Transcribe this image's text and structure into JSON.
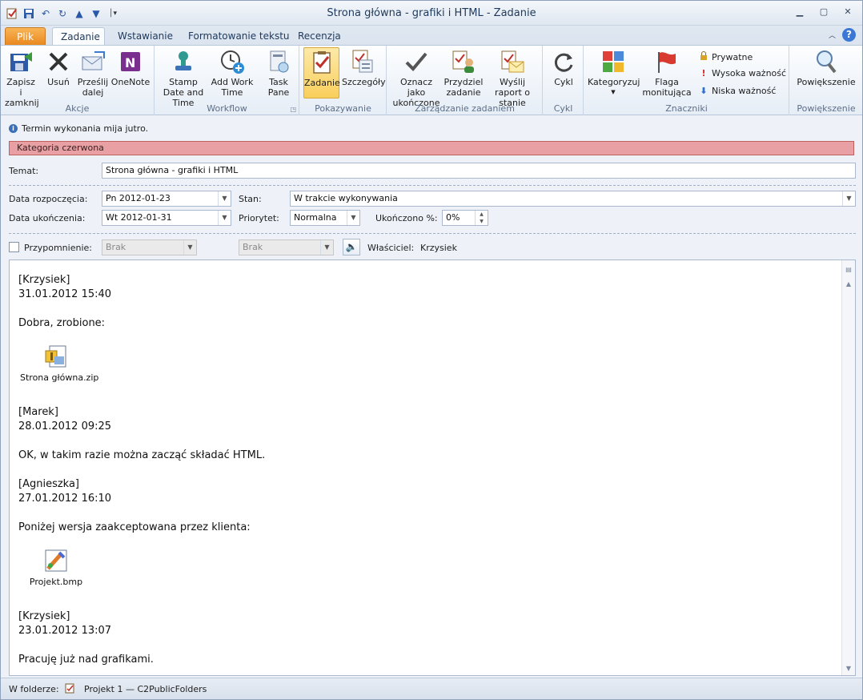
{
  "window": {
    "title": "Strona główna - grafiki i HTML  -  Zadanie"
  },
  "tabs": [
    {
      "label": "Plik"
    },
    {
      "label": "Zadanie"
    },
    {
      "label": "Wstawianie"
    },
    {
      "label": "Formatowanie tekstu"
    },
    {
      "label": "Recenzja"
    }
  ],
  "ribbon": {
    "akcje": {
      "label": "Akcje",
      "save": "Zapisz i zamknij",
      "delete": "Usuń",
      "forward": "Prześlij dalej",
      "onenote": "OneNote"
    },
    "workflow": {
      "label": "Workflow",
      "stamp": "Stamp Date and Time",
      "addwork": "Add Work Time",
      "taskpane": "Task Pane"
    },
    "pokazywanie": {
      "label": "Pokazywanie",
      "zadanie": "Zadanie",
      "szczegoly": "Szczegóły"
    },
    "zarzadzanie": {
      "label": "Zarządzanie zadaniem",
      "oznacz": "Oznacz jako ukończone",
      "przydziel": "Przydziel zadanie",
      "wyslij": "Wyślij raport o stanie"
    },
    "cykl": {
      "label": "Cykl",
      "cykl": "Cykl"
    },
    "znaczniki": {
      "label": "Znaczniki",
      "kategoryzuj": "Kategoryzuj",
      "flaga": "Flaga monitująca",
      "prywatne": "Prywatne",
      "wysoka": "Wysoka ważność",
      "niska": "Niska ważność"
    },
    "powiekszenie": {
      "label": "Powiększenie",
      "powiekszenie": "Powiększenie"
    }
  },
  "form": {
    "info": "Termin wykonania mija jutro.",
    "category": "Kategoria czerwona",
    "subject_label": "Temat:",
    "subject": "Strona główna - grafiki i HTML",
    "start_label": "Data rozpoczęcia:",
    "start": "Pn 2012-01-23",
    "due_label": "Data ukończenia:",
    "due": "Wt 2012-01-31",
    "status_label": "Stan:",
    "status": "W trakcie wykonywania",
    "priority_label": "Priorytet:",
    "priority": "Normalna",
    "complete_label": "Ukończono %:",
    "complete": "0%",
    "reminder_label": "Przypomnienie:",
    "reminder_date": "Brak",
    "reminder_time": "Brak",
    "owner_label": "Właściciel:",
    "owner": "Krzysiek"
  },
  "body": {
    "entries": [
      {
        "author": "[Krzysiek]",
        "time": "31.01.2012 15:40",
        "text": "Dobra, zrobione:",
        "attachment": "Strona główna.zip"
      },
      {
        "author": "[Marek]",
        "time": "28.01.2012 09:25",
        "text": "OK, w takim razie można zacząć składać HTML."
      },
      {
        "author": "[Agnieszka]",
        "time": "27.01.2012 16:10",
        "text": "Poniżej wersja zaakceptowana przez klienta:",
        "attachment": "Projekt.bmp"
      },
      {
        "author": "[Krzysiek]",
        "time": "23.01.2012 13:07",
        "text": "Pracuję już nad grafikami."
      }
    ]
  },
  "statusbar": {
    "folder_label": "W folderze:",
    "folder": "Projekt 1 — C2PublicFolders"
  },
  "colors": {
    "category_red": "#e8a0a4",
    "file_tab": "#e8871c",
    "selected_button": "#f9cf5c"
  }
}
